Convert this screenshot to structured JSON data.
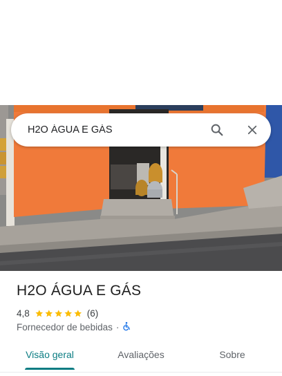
{
  "search": {
    "value": "H2O ÁGUA E GÁS",
    "search_icon": "search-icon",
    "close_icon": "close-icon"
  },
  "place": {
    "name": "H2O ÁGUA E GÁS",
    "rating": "4,8",
    "stars": 5,
    "review_count": "(6)",
    "category": "Fornecedor de bebidas",
    "separator": "·",
    "accessibility_icon": "wheelchair-icon"
  },
  "tabs": [
    {
      "label": "Visão geral",
      "active": true
    },
    {
      "label": "Avaliações",
      "active": false
    },
    {
      "label": "Sobre",
      "active": false
    }
  ],
  "colors": {
    "accent": "#0a7c82",
    "star": "#fbbc04",
    "wall_orange": "#f07a3a",
    "accessibility_blue": "#1a73e8"
  }
}
